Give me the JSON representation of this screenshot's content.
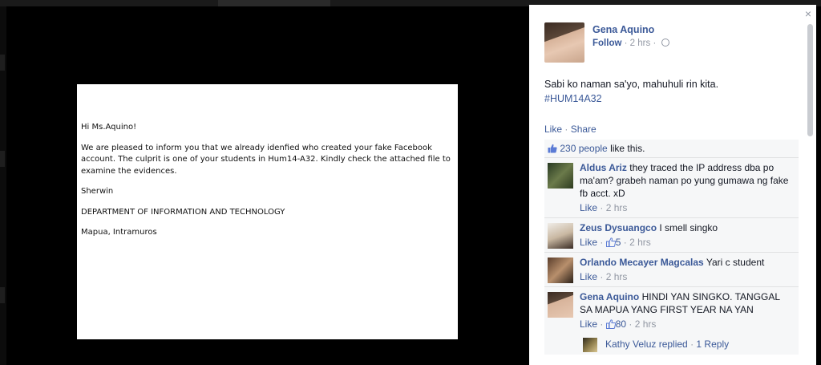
{
  "top_strip": {
    "ghost_text": ""
  },
  "photo": {
    "paragraphs": [
      "Hi Ms.Aquino!",
      "We are pleased to inform you that we already idenfied who created your fake Facebook account. The culprit is one of your students in Hum14-A32.  Kindly check the attached file to examine the evidences.",
      "Sherwin",
      "DEPARTMENT OF INFORMATION AND TECHNOLOGY",
      "Mapua,  Intramuros"
    ]
  },
  "panel": {
    "close_label": "×",
    "author": {
      "name": "Gena Aquino",
      "follow": "Follow",
      "separator": "·",
      "time": "2 hrs",
      "privacy_icon": "globe-icon"
    },
    "post": {
      "text_line1": "Sabi ko naman sa'yo, mahuhuli rin kita.",
      "hashtag": "#HUM14A32"
    },
    "actions": {
      "like": "Like",
      "separator": "·",
      "share": "Share"
    },
    "likes": {
      "count_text": "230 people",
      "suffix": " like this."
    },
    "comments": [
      {
        "name": "Aldus Ariz",
        "text": " they traced the IP address dba po ma'am? grabeh naman po yung gumawa ng fake fb acct. xD",
        "like": "Like",
        "separator": "·",
        "likes_count": "",
        "time": "2 hrs"
      },
      {
        "name": "Zeus Dysuangco",
        "text": " I smell singko",
        "like": "Like",
        "separator": "·",
        "likes_count": "5",
        "time": "2 hrs"
      },
      {
        "name": "Orlando Mecayer Magcalas",
        "text": " Yari c student",
        "like": "Like",
        "separator": "·",
        "likes_count": "",
        "time": "2 hrs"
      },
      {
        "name": "Gena Aquino",
        "text": " HINDI YAN SINGKO. TANGGAL SA MAPUA YANG FIRST YEAR NA YAN",
        "like": "Like",
        "separator": "·",
        "likes_count": "80",
        "time": "2 hrs"
      }
    ],
    "reply": {
      "text": "Kathy Veluz replied",
      "separator": "·",
      "count": "1 Reply"
    }
  },
  "colors": {
    "link": "#3b5998",
    "meta": "#9197a3",
    "ufi_bg": "#f6f7f8",
    "backdrop": "#000000"
  }
}
